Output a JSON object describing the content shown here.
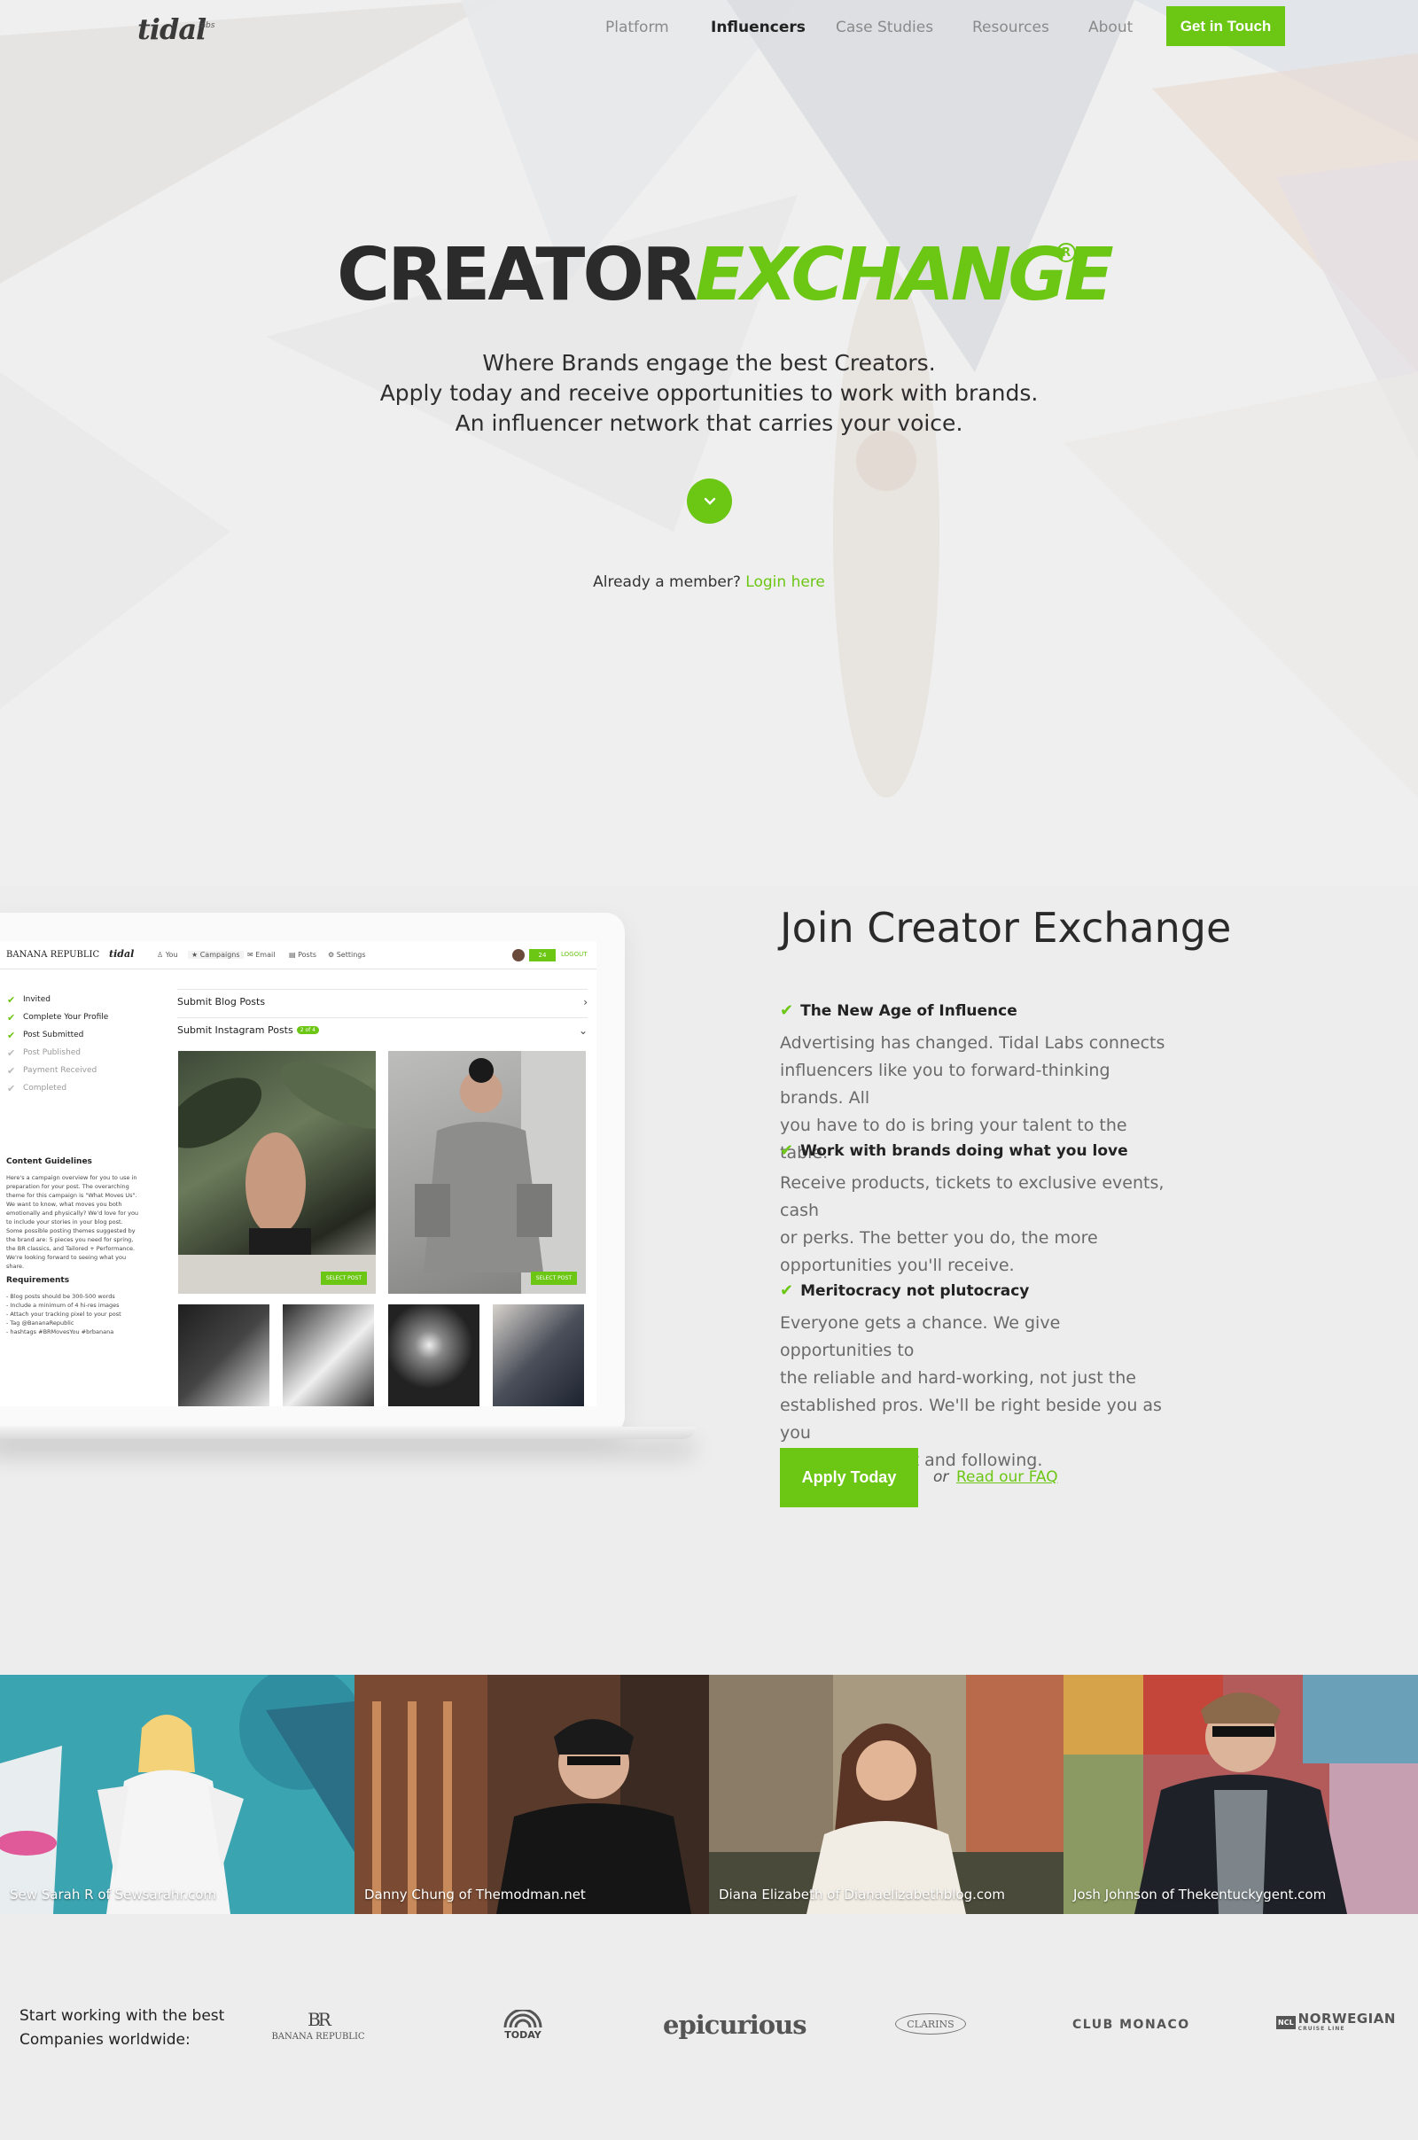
{
  "nav": {
    "logo": "tidal",
    "logo_sup": "labs",
    "links": [
      "Platform",
      "Influencers",
      "Case Studies",
      "Resources",
      "About"
    ],
    "active": "Influencers",
    "cta": "Get in Touch"
  },
  "hero": {
    "wordmark_a": "CREATOR",
    "wordmark_b": "EXCHANGE",
    "registered": "R",
    "lines": [
      "Where Brands engage the best Creators.",
      "Apply today and receive opportunities to work with brands.",
      "An influencer network that carries your voice."
    ],
    "member_text": "Already a member?",
    "login_link": "Login here"
  },
  "dashboard": {
    "brand": "BANANA REPUBLIC",
    "partner": "tidal",
    "tabs": [
      "You",
      "Campaigns",
      "Email",
      "Posts",
      "Settings"
    ],
    "pill": "24",
    "logout": "LOGOUT",
    "steps": [
      {
        "label": "Invited",
        "done": true
      },
      {
        "label": "Complete Your Profile",
        "done": true
      },
      {
        "label": "Post Submitted",
        "done": true
      },
      {
        "label": "Post Published",
        "done": false
      },
      {
        "label": "Payment Received",
        "done": false
      },
      {
        "label": "Completed",
        "done": false
      }
    ],
    "guidelines_title": "Content Guidelines",
    "guidelines_text": "Here's a campaign overview for you to use in preparation for your post. The overarching theme for this campaign is \"What Moves Us\". We want to know, what moves you both emotionally and physically? We'd love for you to include your stories in your blog post. Some possible posting themes suggested by the brand are: 5 pieces you need for spring, the BR classics, and Tailored + Performance. We're looking forward to seeing what you share.",
    "requirements_title": "Requirements",
    "requirements": [
      "- Blog posts should be 300-500 words",
      "- Include a minimum of 4 hi-res images",
      "- Attach your tracking pixel to your post",
      "- Tag @BananaRepublic",
      "- hashtags #BRMovesYou #brbanana"
    ],
    "submit_blog": "Submit Blog Posts",
    "submit_insta": "Submit Instagram Posts",
    "insta_badge": "2 of 4",
    "select_post": "SELECT POST"
  },
  "join": {
    "title": "Join Creator Exchange",
    "features": [
      {
        "heading": "The New Age of Influence",
        "lines": [
          "Advertising has changed. Tidal Labs connects",
          "influencers like you to forward-thinking brands. All",
          "you have to do is bring your talent to the table."
        ]
      },
      {
        "heading": "Work with brands doing what you love",
        "lines": [
          "Receive products, tickets to exclusive events, cash",
          "or perks.  The better you do, the more",
          "opportunities you'll receive."
        ]
      },
      {
        "heading": "Meritocracy not plutocracy",
        "lines": [
          "Everyone gets a chance. We give opportunities to",
          "the reliable and hard-working, not just the",
          "established pros. We'll be right beside you as you",
          "build your talent and following."
        ]
      }
    ],
    "apply": "Apply Today",
    "or": "or",
    "faq": "Read our FAQ"
  },
  "influencers": [
    {
      "caption": "Sew Sarah R of Sewsarahr.com"
    },
    {
      "caption": "Danny Chung of Themodman.net"
    },
    {
      "caption": "Diana Elizabeth of Dianaelizabethblog.com"
    },
    {
      "caption": "Josh Johnson of Thekentuckygent.com"
    }
  ],
  "partners": {
    "intro": "Start working with the best Companies worldwide:",
    "logos": [
      "BANANA REPUBLIC",
      "TODAY",
      "epicurious",
      "CLARINS",
      "CLUB MONACO",
      "NORWEGIAN",
      "CRUISE LINE"
    ],
    "br_mark": "BR",
    "ncl_mark": "NCL"
  },
  "colors": {
    "accent": "#6cc614",
    "text": "#2a2a2a",
    "muted": "#6a6a6a",
    "background": "#ededed"
  }
}
